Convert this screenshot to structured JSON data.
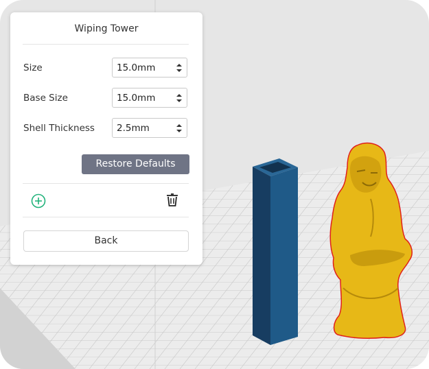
{
  "panel": {
    "title": "Wiping Tower",
    "rows": [
      {
        "label": "Size",
        "value": "15.0mm"
      },
      {
        "label": "Base Size",
        "value": "15.0mm"
      },
      {
        "label": "Shell Thickness",
        "value": "2.5mm"
      }
    ],
    "restore_label": "Restore Defaults",
    "back_label": "Back"
  },
  "icons": {
    "add": "add-circle-icon",
    "delete": "trash-icon",
    "stepper": "up-down-arrows-icon"
  },
  "colors": {
    "tower": "#1f4f78",
    "model": "#e7b817",
    "model_outline": "#e0201b",
    "restore_button": "#6f7485",
    "add_icon": "#20b27a"
  }
}
